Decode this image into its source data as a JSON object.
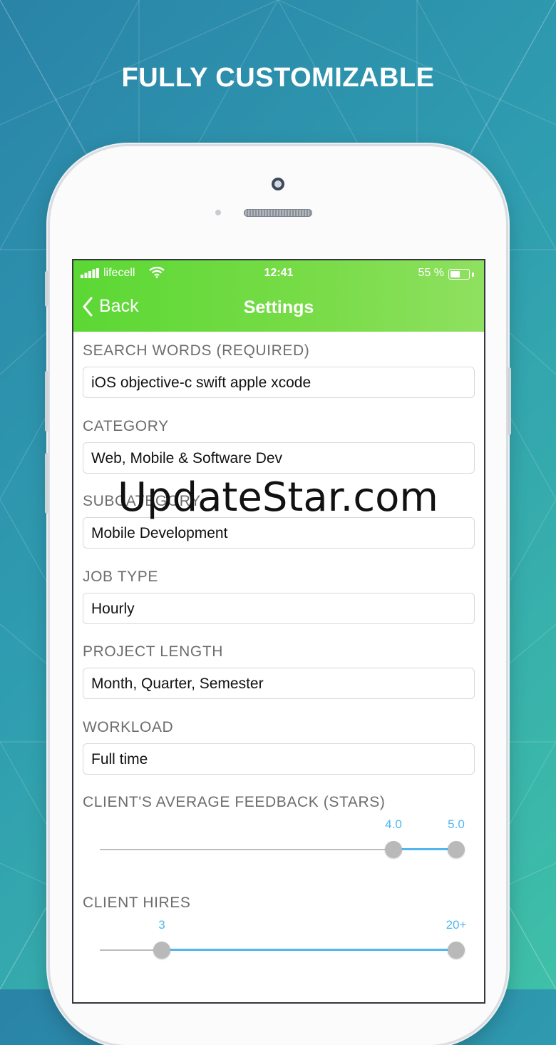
{
  "headline": "FULLY CUSTOMIZABLE",
  "status_bar": {
    "carrier": "lifecell",
    "time": "12:41",
    "battery": "55 %",
    "battery_level": 0.55
  },
  "nav": {
    "back_label": "Back",
    "title": "Settings"
  },
  "fields": [
    {
      "label": "SEARCH WORDS (REQUIRED)",
      "value": "iOS objective-c swift apple xcode"
    },
    {
      "label": "CATEGORY",
      "value": "Web, Mobile & Software Dev"
    },
    {
      "label": "SUBCATEGORY",
      "value": "Mobile Development"
    },
    {
      "label": "JOB TYPE",
      "value": "Hourly"
    },
    {
      "label": "PROJECT LENGTH",
      "value": "Month, Quarter, Semester"
    },
    {
      "label": "WORKLOAD",
      "value": "Full time"
    }
  ],
  "sliders": [
    {
      "label": "CLIENT'S AVERAGE FEEDBACK (STARS)",
      "min_label": "4.0",
      "max_label": "5.0",
      "low_fraction": 0.8,
      "high_fraction": 1.0
    },
    {
      "label": "CLIENT HIRES",
      "min_label": "3",
      "max_label": "20+",
      "low_fraction": 0.15,
      "high_fraction": 1.0
    }
  ],
  "watermark": "UpdateStar.com",
  "colors": {
    "nav_green": "#5bd834",
    "slider_blue": "#4fb7ee",
    "thumb_gray": "#b9b9b9"
  },
  "icons": [
    "signal-icon",
    "wifi-icon",
    "battery-icon",
    "chevron-left-icon"
  ]
}
